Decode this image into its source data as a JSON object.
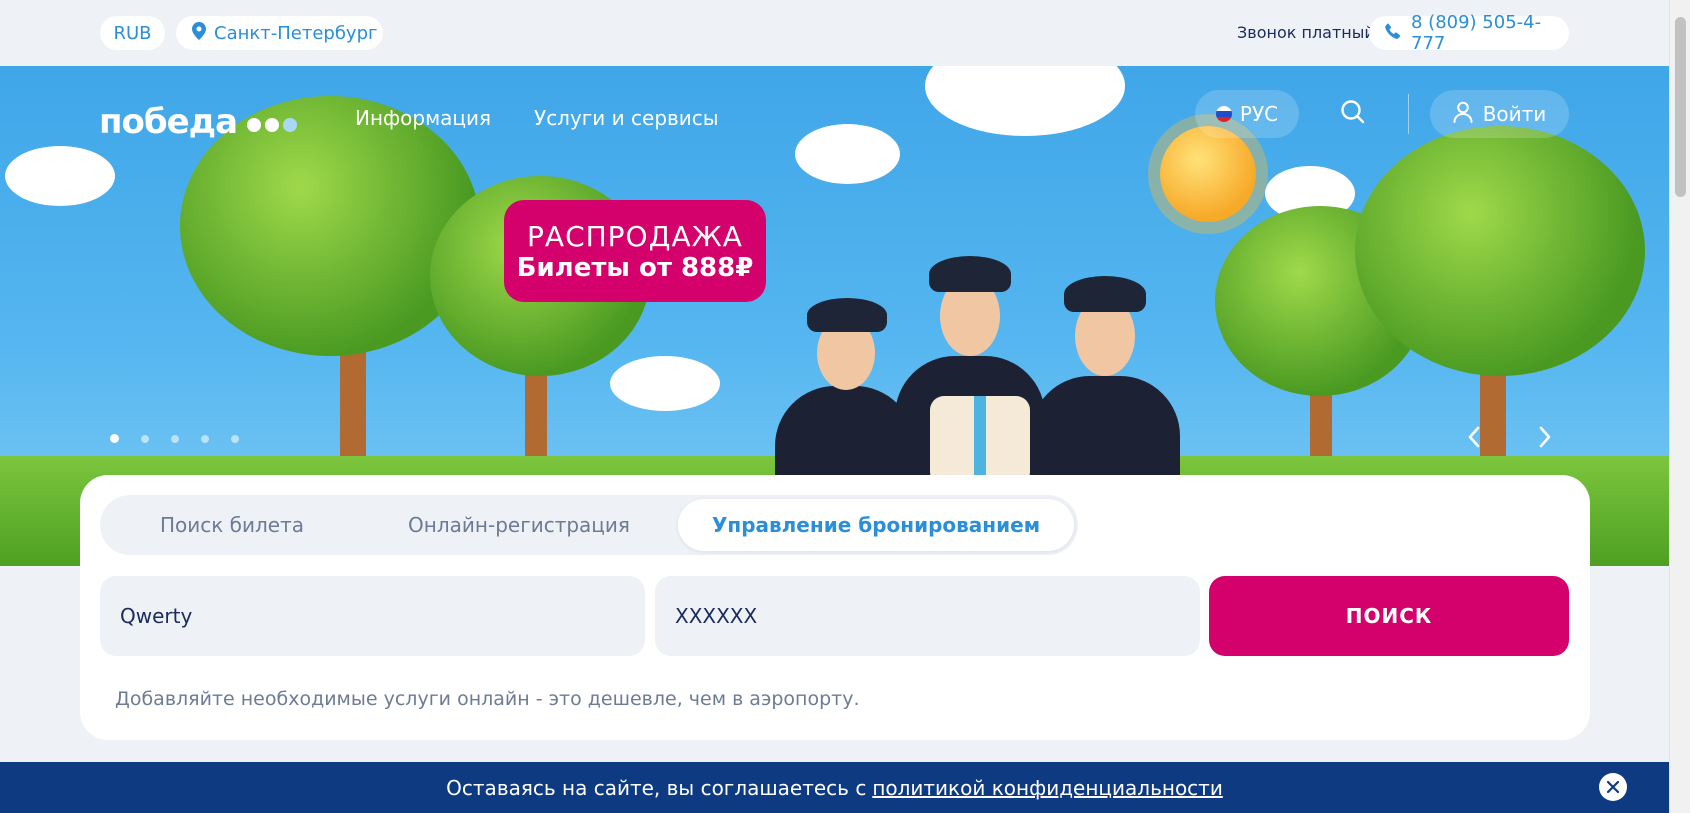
{
  "topbar": {
    "currency": "RUB",
    "city": "Санкт-Петербург",
    "call_note": "Звонок платный",
    "phone": "8 (809) 505-4-777"
  },
  "header": {
    "logo_text": "победа",
    "logo_dot_colors": [
      "#ffffff",
      "#ffffff",
      "#a9d8f5"
    ],
    "nav": [
      "Информация",
      "Услуги и сервисы"
    ],
    "language": "РУС",
    "login": "Войти"
  },
  "hero": {
    "sale_title": "РАСПРОДАЖА",
    "sale_subtitle": "Билеты от 888₽",
    "slide_count": 5,
    "active_slide": 1
  },
  "booking": {
    "tabs": [
      "Поиск билета",
      "Онлайн-регистрация",
      "Управление бронированием"
    ],
    "active_tab": 2,
    "surname_value": "Qwerty",
    "code_value": "XXXXXX",
    "search_button": "ПОИСК",
    "hint": "Добавляйте необходимые услуги онлайн - это дешевле, чем в аэропорту."
  },
  "cookie": {
    "text": "Оставаясь на сайте, вы соглашаетесь с",
    "link": "политикой конфиденциальности"
  },
  "colors": {
    "brand_blue": "#2a8ed8",
    "brand_magenta": "#d4006b",
    "navy": "#0e3a82"
  }
}
